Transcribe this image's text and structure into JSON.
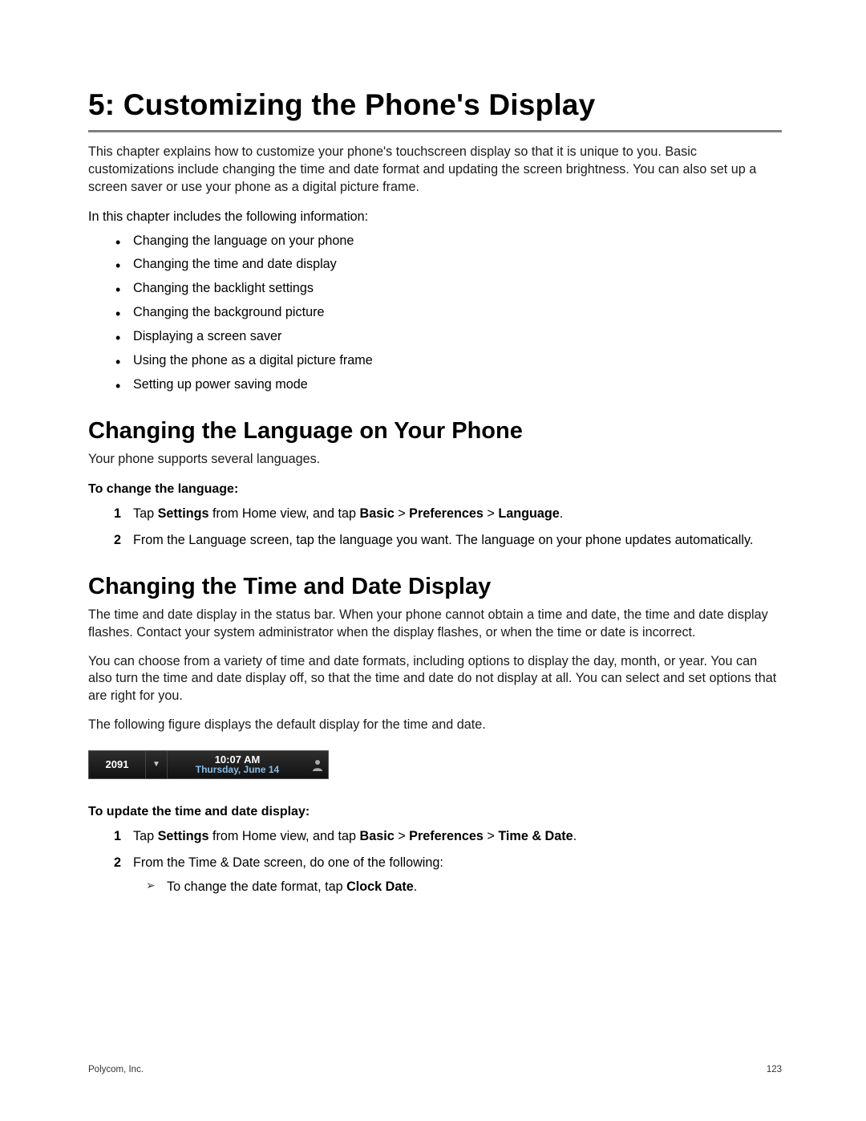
{
  "chapter_title": "5: Customizing the Phone's Display",
  "intro_p1": "This chapter explains how to customize your phone's touchscreen display so that it is unique to you. Basic customizations include changing the time and date format and updating the screen brightness. You can also set up a screen saver or use your phone as a digital picture frame.",
  "intro_p2": "In this chapter includes the following information:",
  "topic_list": [
    "Changing the language on your phone",
    "Changing the time and date display",
    "Changing the backlight settings",
    "Changing the background picture",
    "Displaying a screen saver",
    "Using the phone as a digital picture frame",
    "Setting up power saving mode"
  ],
  "section1_title": "Changing the Language on Your Phone",
  "section1_p1": "Your phone supports several languages.",
  "section1_label": "To change the language:",
  "s1step1": {
    "pre": "Tap ",
    "b1": "Settings",
    "mid1": " from Home view, and tap ",
    "b2": "Basic",
    "gt1": " > ",
    "b3": "Preferences",
    "gt2": " > ",
    "b4": "Language",
    "post": "."
  },
  "s1step2": "From the Language screen, tap the language you want. The language on your phone updates automatically.",
  "section2_title": "Changing the Time and Date Display",
  "section2_p1": "The time and date display in the status bar. When your phone cannot obtain a time and date, the time and date display flashes. Contact your system administrator when the display flashes, or when the time or date is incorrect.",
  "section2_p2": "You can choose from a variety of time and date formats, including options to display the day, month, or year. You can also turn the time and date display off, so that the time and date do not display at all.  You can select and set options that are right for you.",
  "section2_p3": "The following figure displays the default display for the time and date.",
  "status_bar": {
    "ext": "2091",
    "time": "10:07 AM",
    "date": "Thursday, June 14"
  },
  "section2_label": "To update the time and date display:",
  "s2step1": {
    "pre": "Tap ",
    "b1": "Settings",
    "mid1": " from Home view, and tap ",
    "b2": "Basic",
    "gt1": " > ",
    "b3": "Preferences",
    "gt2": " > ",
    "b4": "Time & Date",
    "post": "."
  },
  "s2step2": "From the Time & Date screen, do one of the following:",
  "s2sub1": {
    "pre": "To change the date format, tap ",
    "b1": "Clock Date",
    "post": "."
  },
  "footer": {
    "company": "Polycom, Inc.",
    "page": "123"
  }
}
